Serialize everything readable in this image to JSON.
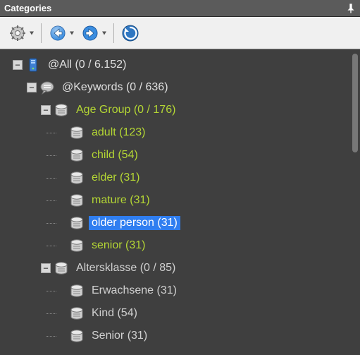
{
  "title": "Categories",
  "toolbar": {
    "settings": "settings",
    "back": "back",
    "forward": "forward",
    "refresh": "refresh"
  },
  "tree": {
    "root": {
      "label": "@All (0 / 6.152)",
      "expanded": true,
      "children": [
        {
          "key": "keywords",
          "label": "@Keywords (0 / 636)",
          "expanded": true,
          "children": [
            {
              "key": "agegroup",
              "label": "Age Group (0 / 176)",
              "expanded": true,
              "highlight": "green",
              "children": [
                {
                  "key": "adult",
                  "label": "adult (123)"
                },
                {
                  "key": "child",
                  "label": "child (54)"
                },
                {
                  "key": "elder",
                  "label": "elder (31)"
                },
                {
                  "key": "mature",
                  "label": "mature (31)"
                },
                {
                  "key": "olderperson",
                  "label": "older person (31)",
                  "selected": true
                },
                {
                  "key": "senior",
                  "label": "senior (31)"
                }
              ]
            },
            {
              "key": "altersklasse",
              "label": "Altersklasse (0 / 85)",
              "expanded": true,
              "highlight": "gray",
              "children": [
                {
                  "key": "erwachsene",
                  "label": "Erwachsene (31)"
                },
                {
                  "key": "kind",
                  "label": "Kind (54)"
                },
                {
                  "key": "senior_de",
                  "label": "Senior (31)"
                }
              ]
            }
          ]
        }
      ]
    }
  }
}
